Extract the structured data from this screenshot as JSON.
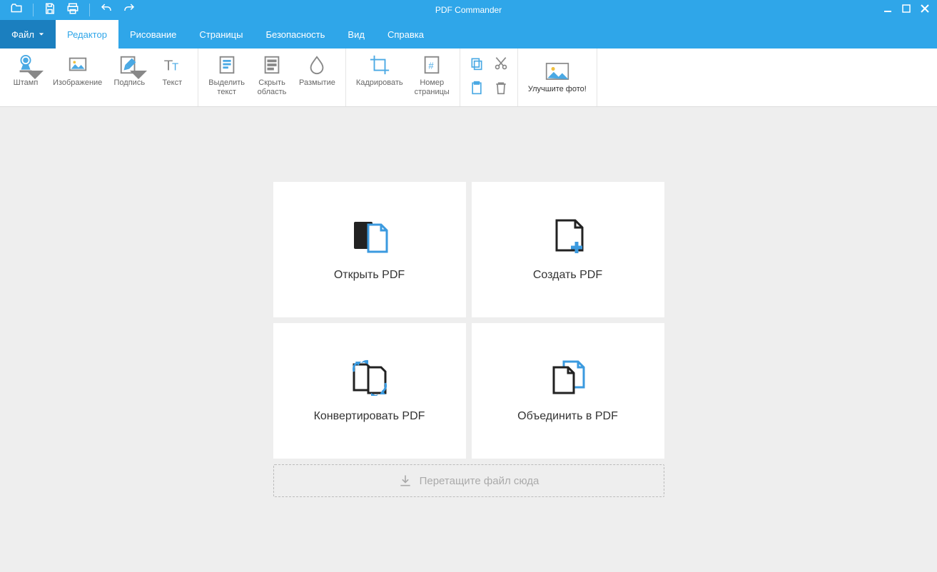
{
  "app": {
    "title": "PDF Commander"
  },
  "tabs": {
    "file": "Файл",
    "editor": "Редактор",
    "drawing": "Рисование",
    "pages": "Страницы",
    "security": "Безопасность",
    "view": "Вид",
    "help": "Справка"
  },
  "ribbon": {
    "stamp": "Штамп",
    "image": "Изображение",
    "signature": "Подпись",
    "text": "Текст",
    "highlight": "Выделить\nтекст",
    "hide": "Скрыть\nобласть",
    "blur": "Размытие",
    "crop": "Кадрировать",
    "pagenum": "Номер\nстраницы",
    "promo": "Улучшите фото!"
  },
  "cards": {
    "open": "Открыть PDF",
    "create": "Создать PDF",
    "convert": "Конвертировать PDF",
    "merge": "Объединить в PDF"
  },
  "dropzone": "Перетащите файл сюда"
}
